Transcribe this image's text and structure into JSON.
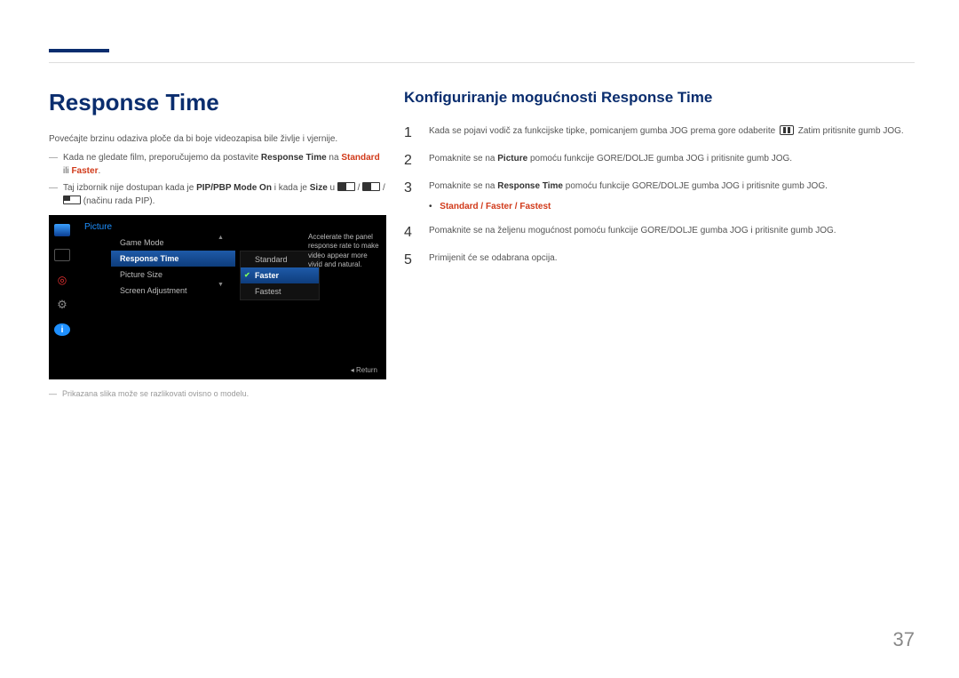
{
  "page_number": "37",
  "left": {
    "heading": "Response Time",
    "intro": "Povećajte brzinu odaziva ploče da bi boje videozapisa bile življe i vjernije.",
    "note1_a": "Kada ne gledate film, preporučujemo da postavite ",
    "note1_b": "Response Time",
    "note1_c": " na ",
    "note1_d": "Standard",
    "note1_e": " ili ",
    "note1_f": "Faster",
    "note1_g": ".",
    "note2_a": "Taj izbornik nije dostupan kada je ",
    "note2_b": "PIP/PBP Mode",
    "note2_c": " ",
    "note2_d": "On",
    "note2_e": " i kada je ",
    "note2_f": "Size",
    "note2_g": " u",
    "note2_h": " (načinu rada PIP).",
    "disclaimer": "Prikazana slika može se razlikovati ovisno o modelu."
  },
  "osd": {
    "title": "Picture",
    "menu1": [
      "Game Mode",
      "Response Time",
      "Picture Size",
      "Screen Adjustment"
    ],
    "menu1_sel_index": 1,
    "menu2": [
      "Standard",
      "Faster",
      "Fastest"
    ],
    "menu2_sel_index": 1,
    "desc": "Accelerate the panel response rate to make video appear more vivid and natural.",
    "return": "Return"
  },
  "right": {
    "heading": "Konfiguriranje mogućnosti Response Time",
    "steps": {
      "s1_a": "Kada se pojavi vodič za funkcijske tipke, pomicanjem gumba JOG prema gore odaberite ",
      "s1_b": " Zatim pritisnite gumb JOG.",
      "s2_a": "Pomaknite se na ",
      "s2_b": "Picture",
      "s2_c": " pomoću funkcije GORE/DOLJE gumba JOG i pritisnite gumb JOG.",
      "s3_a": "Pomaknite se na ",
      "s3_b": "Response Time",
      "s3_c": " pomoću funkcije GORE/DOLJE gumba JOG i pritisnite gumb JOG.",
      "bullet": {
        "a": "Standard",
        "sep": " / ",
        "b": "Faster",
        "c": "Fastest"
      },
      "s4": "Pomaknite se na željenu mogućnost pomoću funkcije GORE/DOLJE gumba JOG i pritisnite gumb JOG.",
      "s5": "Primijenit će se odabrana opcija."
    }
  }
}
